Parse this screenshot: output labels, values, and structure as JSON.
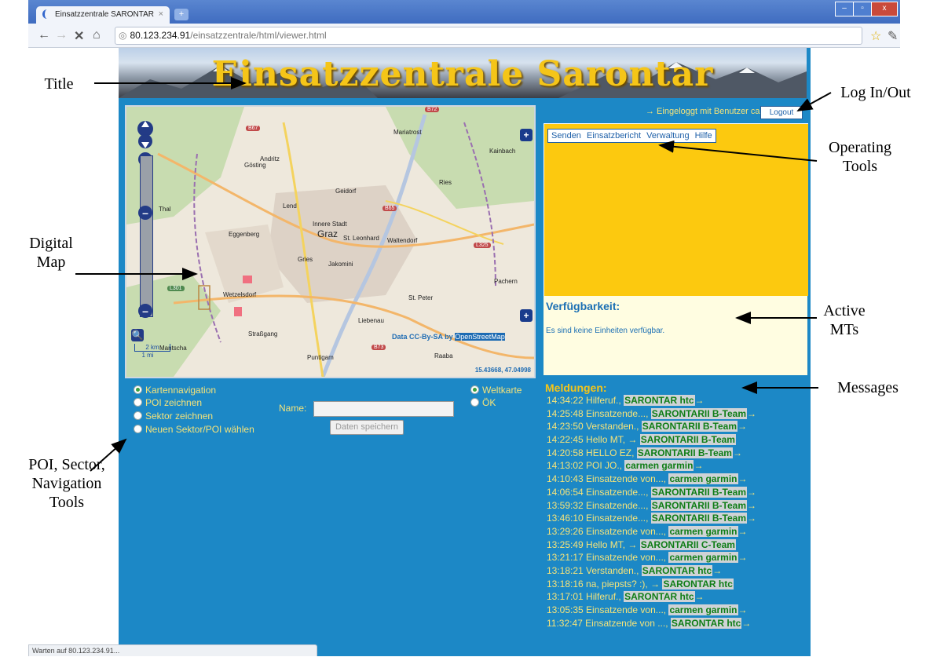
{
  "browser": {
    "tab_title": "Einsatzzentrale SARONTAR",
    "tab_close": "×",
    "new_tab": "+",
    "url_host": "80.123.234.91",
    "url_path": "/einsatzzentrale/html/viewer.html",
    "status_text": "Warten auf 80.123.234.91..."
  },
  "banner": {
    "title": "Einsatzzentrale Sarontar"
  },
  "map": {
    "places": [
      "Andritz",
      "Mariatrost",
      "Gösting",
      "Kainbach",
      "Ries",
      "Geidorf",
      "Thal",
      "Lend",
      "Innere Stadt",
      "Graz",
      "St. Leonhard",
      "Waltendorf",
      "Eggenberg",
      "Gries",
      "Jakomini",
      "Wetzelsdorf",
      "St. Peter",
      "Pachern",
      "Liebenau",
      "Straßgang",
      "Puntigam",
      "Raaba",
      "Mantscha"
    ],
    "roads": [
      "B72",
      "B67",
      "B65",
      "L325",
      "L301",
      "B73"
    ],
    "attribution_prefix": "Data CC-By-SA by",
    "attribution_link": "OpenStreetMap",
    "coordinates": "15.43668, 47.04998",
    "scale_km": "2 km",
    "scale_mi": "1 mi"
  },
  "login": {
    "status": "→ Eingeloggt mit Benutzer carmen",
    "logout_label": "Logout"
  },
  "menu": {
    "items": [
      "Senden",
      "Einsatzbericht",
      "Verwaltung",
      "Hilfe"
    ]
  },
  "availability": {
    "title": "Verfügbarkeit:",
    "text": "Es sind keine Einheiten verfügbar."
  },
  "messages": {
    "title": "Meldungen:",
    "items": [
      {
        "pre": "14:34:22 Hilferuf.,",
        "who": "SARONTAR htc",
        "post": "→"
      },
      {
        "pre": "14:25:48 Einsatzende...,",
        "who": "SARONTARII B-Team",
        "post": "→"
      },
      {
        "pre": "14:23:50 Verstanden.,",
        "who": "SARONTARII B-Team",
        "post": "→"
      },
      {
        "pre": "14:22:45 Hello MT, →",
        "who": "SARONTARII B-Team",
        "post": ""
      },
      {
        "pre": "14:20:58 HELLO EZ,",
        "who": "SARONTARII B-Team",
        "post": "→"
      },
      {
        "pre": "14:13:02 POI JO.,",
        "who": "carmen garmin",
        "post": "→"
      },
      {
        "pre": "14:10:43 Einsatzende von...,",
        "who": "carmen garmin",
        "post": "→"
      },
      {
        "pre": "14:06:54 Einsatzende...,",
        "who": "SARONTARII B-Team",
        "post": "→"
      },
      {
        "pre": "13:59:32 Einsatzende...,",
        "who": "SARONTARII B-Team",
        "post": "→"
      },
      {
        "pre": "13:46:10 Einsatzende...,",
        "who": "SARONTARII B-Team",
        "post": "→"
      },
      {
        "pre": "13:29:26 Einsatzende von...,",
        "who": "carmen garmin",
        "post": "→"
      },
      {
        "pre": "13:25:49 Hello MT, →",
        "who": "SARONTARII C-Team",
        "post": ""
      },
      {
        "pre": "13:21:17 Einsatzende von...,",
        "who": "carmen garmin",
        "post": "→"
      },
      {
        "pre": "13:18:21 Verstanden.,",
        "who": "SARONTAR htc",
        "post": "→"
      },
      {
        "pre": "13:18:16 na, piepsts? :), →",
        "who": "SARONTAR htc",
        "post": ""
      },
      {
        "pre": "13:17:01 Hilferuf.,",
        "who": "SARONTAR htc",
        "post": "→"
      },
      {
        "pre": "13:05:35 Einsatzende von...,",
        "who": "carmen garmin",
        "post": "→"
      },
      {
        "pre": "11:32:47 Einsatzende von ...,",
        "who": "SARONTAR htc",
        "post": "→"
      }
    ]
  },
  "tools": {
    "modes": [
      "Kartennavigation",
      "POI zeichnen",
      "Sektor zeichnen",
      "Neuen Sektor/POI wählen"
    ],
    "selected_mode": "Kartennavigation",
    "map_layers": [
      "Weltkarte",
      "ÖK"
    ],
    "selected_layer": "Weltkarte",
    "name_label": "Name:",
    "name_value": "",
    "save_label": "Daten speichern"
  },
  "annotations": {
    "title": "Title",
    "login": "Log In/Out",
    "operating_tools": "Operating Tools",
    "digital_map": "Digital Map",
    "active_mts": "Active MTs",
    "messages": "Messages",
    "poi_tools": "POI, Sector, Navigation Tools"
  },
  "colors": {
    "page_bg": "#1c88c6",
    "tools_panel": "#fcc90f",
    "availability_panel": "#fffde1",
    "message_text": "#f5e37a",
    "sender_green": "#0f7d16"
  }
}
